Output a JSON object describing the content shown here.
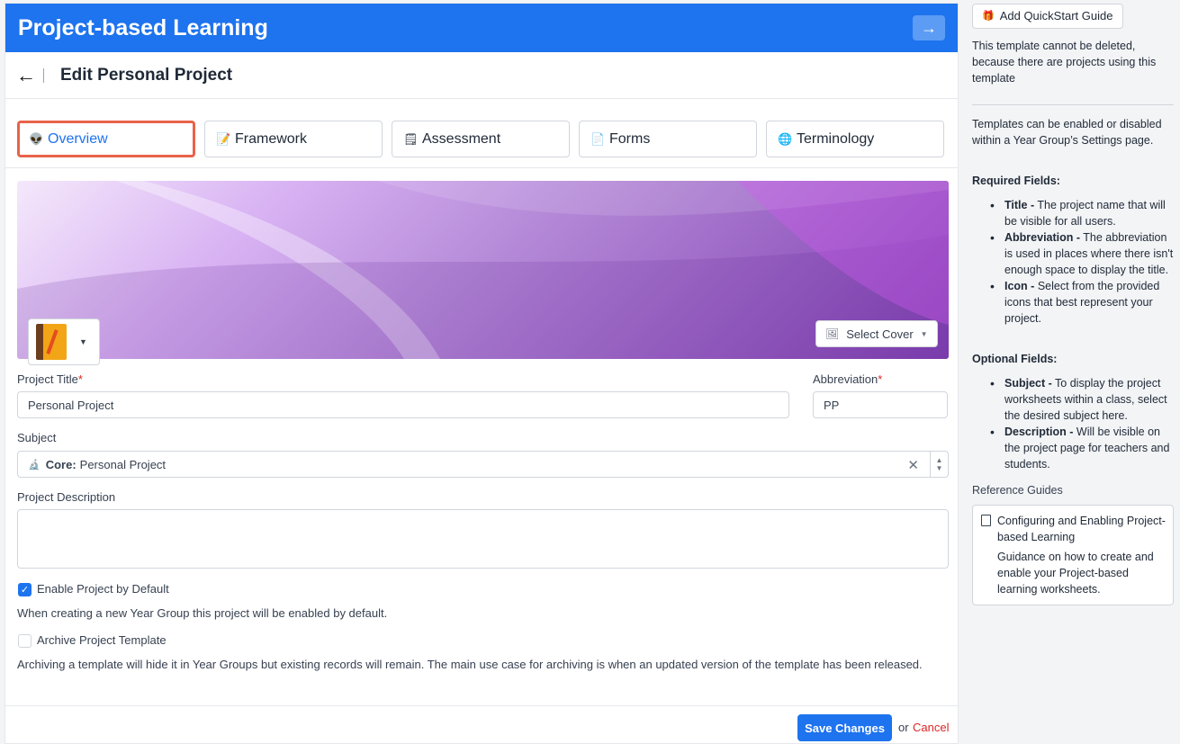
{
  "app": {
    "title": "Project-based Learning"
  },
  "header": {
    "back_icon": "arrow-left-icon",
    "title": "Edit Personal Project"
  },
  "tabs": [
    {
      "label": "Overview",
      "icon": "alien-icon",
      "active": true
    },
    {
      "label": "Framework",
      "icon": "memo-icon",
      "active": false
    },
    {
      "label": "Assessment",
      "icon": "clipboard-icon",
      "active": false
    },
    {
      "label": "Forms",
      "icon": "note-icon",
      "active": false
    },
    {
      "label": "Terminology",
      "icon": "globe-icon",
      "active": false
    }
  ],
  "cover": {
    "select_label": "Select Cover",
    "project_icon": "notebook-pen-icon"
  },
  "form": {
    "project_title_label": "Project Title",
    "project_title_value": "Personal Project",
    "abbreviation_label": "Abbreviation",
    "abbreviation_value": "PP",
    "required_mark": "*",
    "subject_label": "Subject",
    "subject_prefix": "Core:",
    "subject_value": "Personal Project",
    "description_label": "Project Description",
    "description_value": "",
    "enable_label": "Enable Project by Default",
    "enable_checked": true,
    "enable_help": "When creating a new Year Group this project will be enabled by default.",
    "archive_label": "Archive Project Template",
    "archive_checked": false,
    "archive_help": "Archiving a template will hide it in Year Groups but existing records will remain. The main use case for archiving is when an updated version of the template has been released."
  },
  "footer": {
    "save_label": "Save Changes",
    "or_text": "or",
    "cancel_label": "Cancel"
  },
  "sidebar": {
    "quickstart_label": "Add QuickStart Guide",
    "note": "This template cannot be deleted, because there are projects using this template",
    "intro": "Templates can be enabled or disabled within a Year Group’s Settings page.",
    "required_heading": "Required Fields:",
    "required_items": [
      {
        "term": "Title -",
        "text": "The project name that will be visible for all users."
      },
      {
        "term": "Abbreviation -",
        "text": "The abbreviation is used in places where there isn't enough space to display the title."
      },
      {
        "term": "Icon -",
        "text": "Select from the provided icons that best represent your project."
      }
    ],
    "optional_heading": "Optional Fields:",
    "optional_items": [
      {
        "term": "Subject -",
        "text": "To display the project worksheets within a class, select the desired subject here."
      },
      {
        "term": "Description -",
        "text": "Will be visible on the project page for teachers and students."
      }
    ],
    "reference_heading": "Reference Guides",
    "reference_title": "Configuring and Enabling Project-based Learning",
    "reference_desc": "Guidance on how to create and enable your Project-based learning worksheets."
  }
}
